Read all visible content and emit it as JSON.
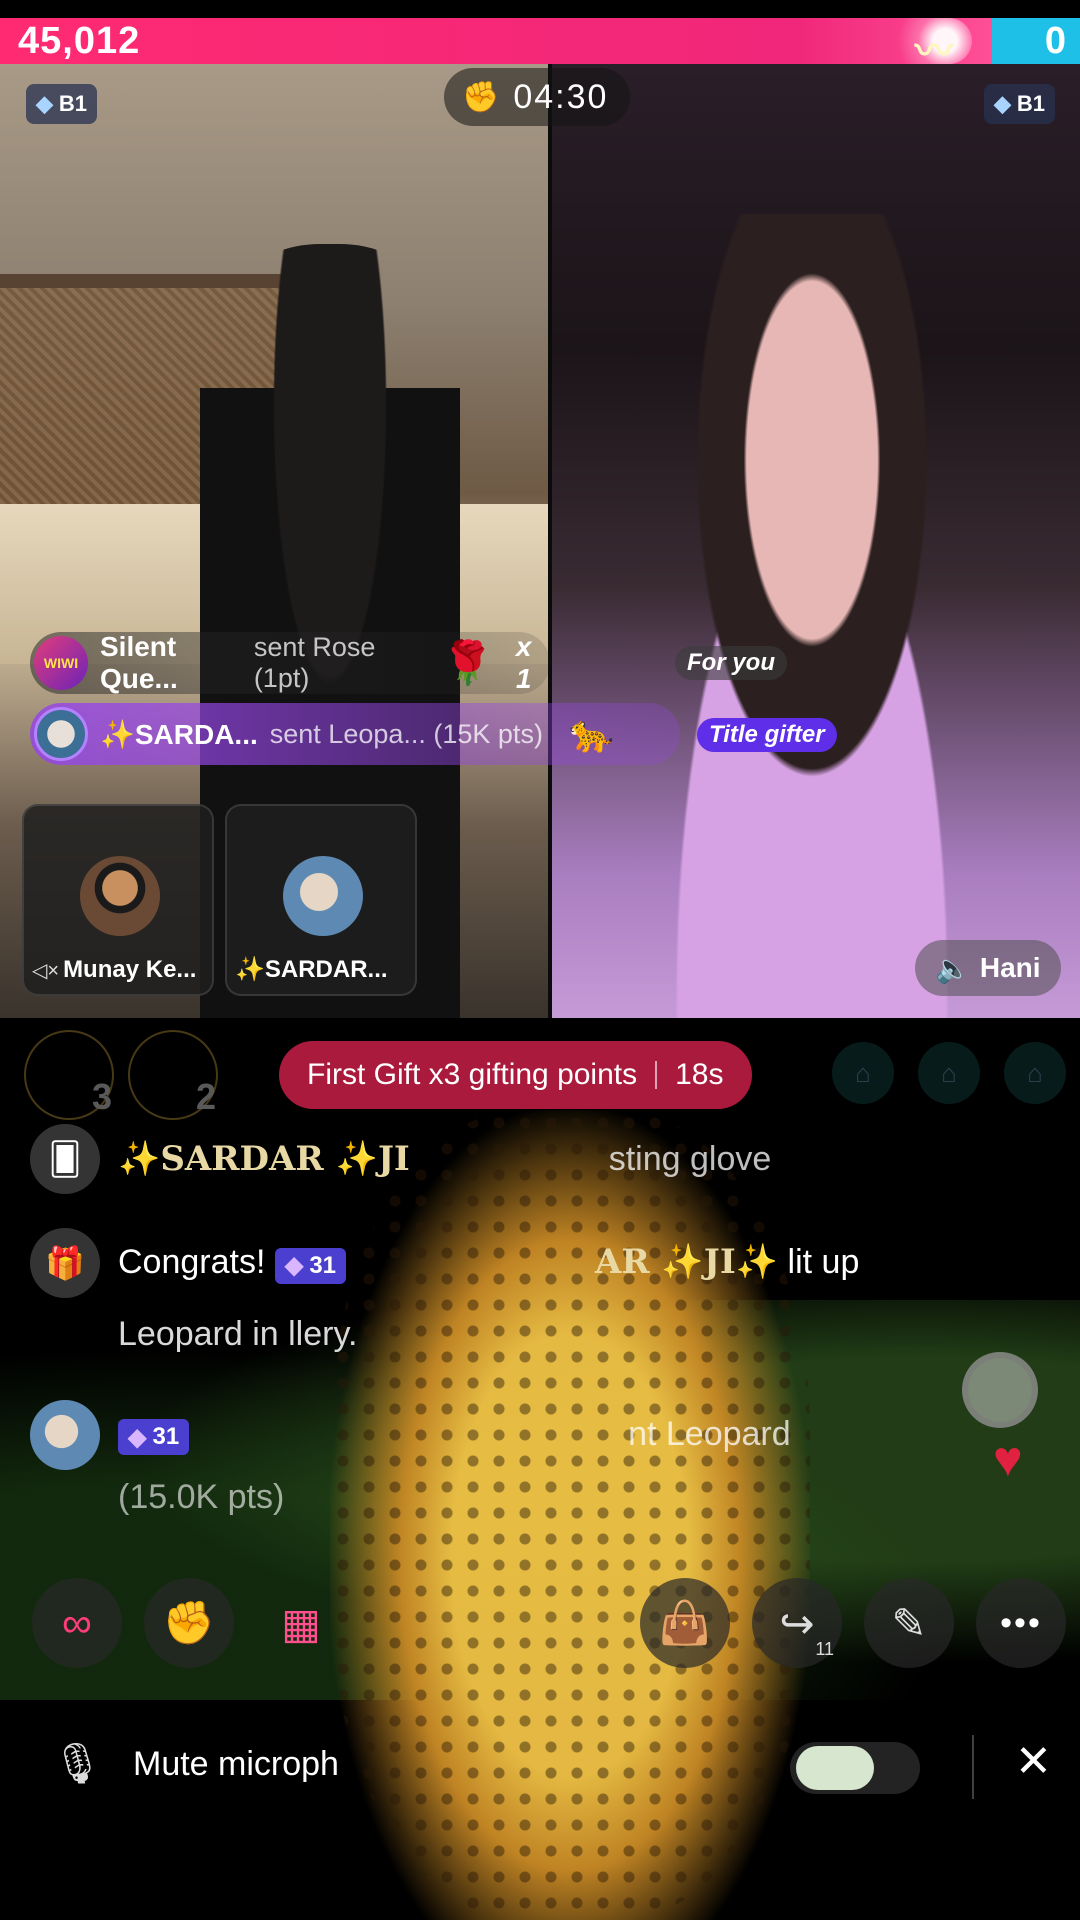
{
  "score": {
    "left": "45,012",
    "right": "0"
  },
  "timer": {
    "value": "04:30"
  },
  "badges": {
    "left": "B1",
    "right": "B1"
  },
  "gift_banners": [
    {
      "name": "Silent Que...",
      "detail": "sent Rose (1pt)",
      "multiplier": "x 1",
      "tag": "For you",
      "avatar_text": "WIWI"
    },
    {
      "name": "✨SARDA...",
      "detail": "sent Leopa... (15K pts)",
      "tag": "Title gifter"
    }
  ],
  "guests": [
    {
      "name": "Munay Ke..."
    },
    {
      "name": "✨SARDAR..."
    }
  ],
  "host": {
    "name": "Hani"
  },
  "first_gift": {
    "text": "First Gift x3 gifting points",
    "countdown": "18s"
  },
  "top_gifters": {
    "rank3": "3",
    "rank2": "2"
  },
  "chat": {
    "line1": {
      "name": "✨SARDAR ✨JI",
      "text": "sting glove"
    },
    "line2": {
      "prefix": "Congrats!",
      "level": "31",
      "name": "AR ✨JI✨",
      "text": "lit up"
    },
    "line2_cont": "Leopard        in            llery.",
    "line3": {
      "level": "31",
      "text": "nt Leopard"
    },
    "line3_cont": "(15.0K pts)"
  },
  "toolbar": {
    "share_count": "11"
  },
  "mic": {
    "label": "Mute microph"
  },
  "icons": {
    "gem": "gem-icon",
    "gloves": "boxing-gloves-icon",
    "speaker": "speaker-icon",
    "gift": "gift-icon",
    "cards": "cards-icon",
    "link": "link-icon",
    "apps": "apps-icon",
    "bag": "shopping-bag-icon",
    "share": "share-icon",
    "magic": "magic-wand-icon",
    "more": "more-icon",
    "mic_off": "mic-off-icon",
    "close": "close-icon"
  },
  "colors": {
    "score_pink": "#f0277a",
    "score_blue": "#1fc0e8",
    "title_tag": "#5e2ee8",
    "first_gift": "#c81e46"
  }
}
